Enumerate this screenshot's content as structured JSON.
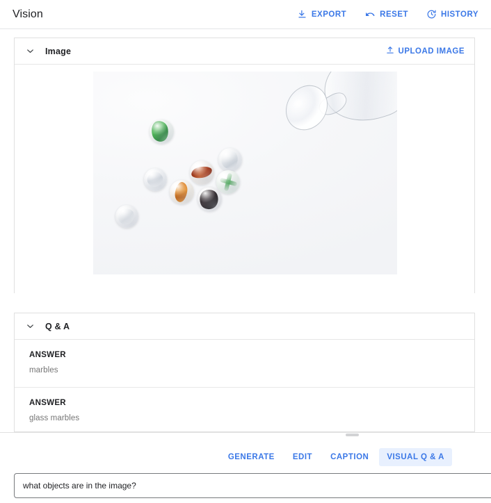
{
  "topbar": {
    "title": "Vision",
    "actions": [
      {
        "label": "EXPORT",
        "icon": "download-icon"
      },
      {
        "label": "RESET",
        "icon": "undo-icon"
      },
      {
        "label": "HISTORY",
        "icon": "history-clock-icon"
      }
    ]
  },
  "image_panel": {
    "title": "Image",
    "collapse_icon": "chevron-down-icon",
    "upload_label": "UPLOAD IMAGE",
    "upload_icon": "upload-icon",
    "photo_alt": "glass marbles spilling out of a tipped clear glass goblet on a white background"
  },
  "qa_panel": {
    "title": "Q & A",
    "collapse_icon": "chevron-down-icon",
    "rows": [
      {
        "label": "ANSWER",
        "value": "marbles"
      },
      {
        "label": "ANSWER",
        "value": "glass marbles"
      }
    ]
  },
  "tabs": [
    {
      "label": "GENERATE",
      "active": false
    },
    {
      "label": "EDIT",
      "active": false
    },
    {
      "label": "CAPTION",
      "active": false
    },
    {
      "label": "VISUAL Q & A",
      "active": true
    }
  ],
  "prompt": {
    "value": "what objects are in the image?",
    "placeholder": "Enter a prompt"
  },
  "colors": {
    "accent_blue": "#3b78e7",
    "active_tab_bg": "#e8f0fe",
    "text_primary": "#202124",
    "text_secondary": "#757575",
    "border": "#e0e0e0"
  }
}
